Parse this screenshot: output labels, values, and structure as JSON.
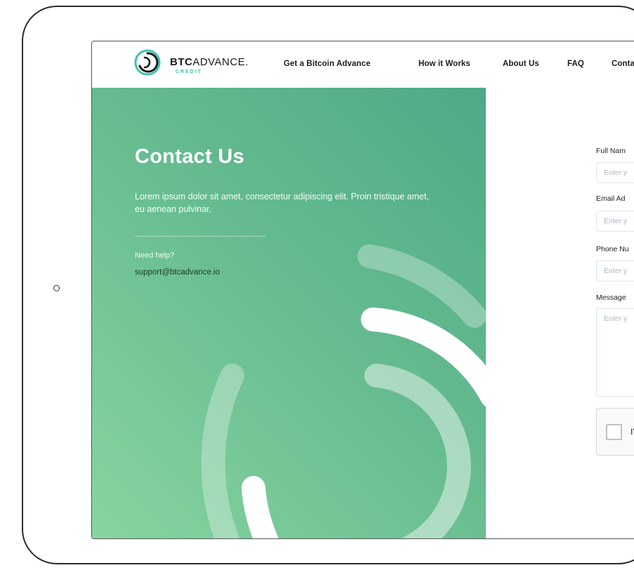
{
  "brand": {
    "name_bold": "BTC",
    "name_rest": "ADVANCE.",
    "sub": "CREDIT",
    "accent": "#38c4b0"
  },
  "nav": {
    "items": [
      {
        "label": "Get a Bitcoin Advance"
      },
      {
        "label": "How it Works"
      },
      {
        "label": "About Us"
      },
      {
        "label": "FAQ"
      },
      {
        "label": "Conta"
      }
    ]
  },
  "hero": {
    "title": "Contact Us",
    "description": "Lorem ipsum dolor sit amet, consectetur adipiscing elit. Proin tristique amet, eu aenean pulvinar.",
    "help_label": "Need help?",
    "email": "support@btcadvance.io",
    "gradient_start": "#4daa86",
    "gradient_end": "#88d4a1"
  },
  "form": {
    "full_name": {
      "label": "Full Nam",
      "placeholder": "Enter y"
    },
    "email": {
      "label": "Email Ad",
      "placeholder": "Enter y"
    },
    "phone": {
      "label": "Phone Nu",
      "placeholder": "Enter y"
    },
    "message": {
      "label": "Message",
      "placeholder": "Enter y"
    },
    "captcha_label": "I'"
  }
}
